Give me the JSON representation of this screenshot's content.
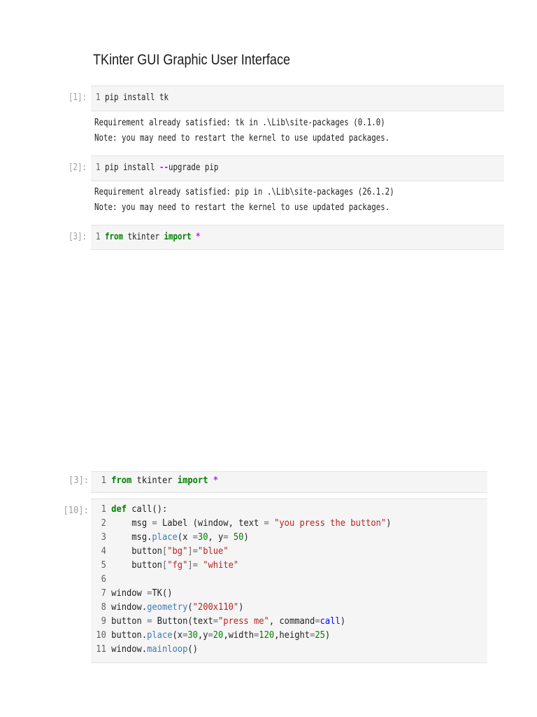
{
  "title": "TKinter GUI Graphic User Interface",
  "cells_top": [
    {
      "prompt": "[1]:",
      "line_no": "1",
      "code": "pip install tk",
      "output": [
        "Requirement already satisfied: tk in .\\Lib\\site-packages (0.1.0)",
        "Note: you may need to restart the kernel to use updated packages."
      ]
    },
    {
      "prompt": "[2]:",
      "line_no": "1",
      "code_a": "pip install ",
      "code_op": "--",
      "code_b": "upgrade pip",
      "output": [
        "Requirement already satisfied: pip in .\\Lib\\site-packages (26.1.2)",
        "Note: you may need to restart the kernel to use updated packages."
      ]
    },
    {
      "prompt": "[3]:",
      "line_no": "1",
      "kw1": "from",
      "mod": " tkinter ",
      "kw2": "import",
      "star": " *"
    }
  ],
  "cells_bottom": [
    {
      "prompt": "[3]:",
      "line_no": "1",
      "kw1": "from",
      "mod": " tkinter ",
      "kw2": "import",
      "star": " *"
    },
    {
      "prompt": "[10]:",
      "lines": [
        {
          "n": "1",
          "t": "def call():"
        },
        {
          "n": "2",
          "t": "    msg = Label (window, text = \"you press the button\")"
        },
        {
          "n": "3",
          "t": "    msg.place(x =30, y= 50)"
        },
        {
          "n": "4",
          "t": "    button[\"bg\"]=\"blue\""
        },
        {
          "n": "5",
          "t": "    button[\"fg\"]= \"white\""
        },
        {
          "n": "6",
          "t": ""
        },
        {
          "n": "7",
          "t": "window =TK()"
        },
        {
          "n": "8",
          "t": "window.geometry(\"200x110\")"
        },
        {
          "n": "9",
          "t": "button = Button(text=\"press me\", command=call)"
        },
        {
          "n": "10",
          "t": "button.place(x=30,y=20,width=120,height=25)"
        },
        {
          "n": "11",
          "t": "window.mainloop()"
        }
      ]
    }
  ]
}
